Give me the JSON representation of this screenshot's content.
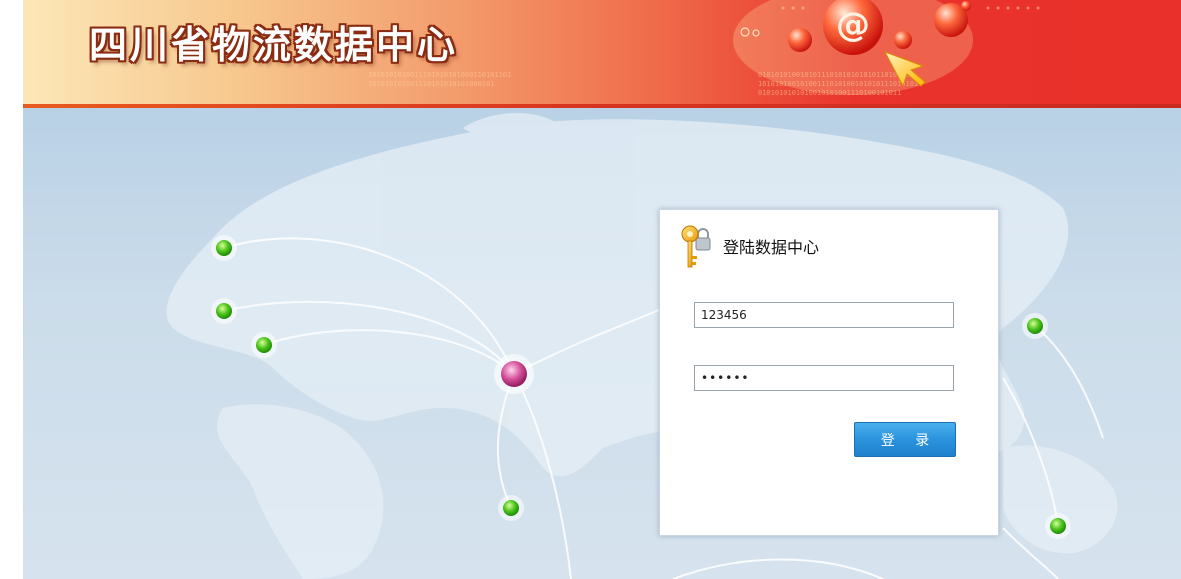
{
  "header": {
    "site_title": "四川省物流数据中心",
    "colors": {
      "gradient_start": "#fce7b8",
      "gradient_end": "#e9302a",
      "title_outline": "#8a2b12"
    }
  },
  "login": {
    "title": "登陆数据中心",
    "icon": "key-lock-icon",
    "username": {
      "value": "123456"
    },
    "password": {
      "value": "123456"
    },
    "submit_label": "登 录",
    "colors": {
      "button": "#2b93dd"
    }
  },
  "map": {
    "hub_node_color": "#d6509a",
    "node_color": "#4cc41c"
  }
}
